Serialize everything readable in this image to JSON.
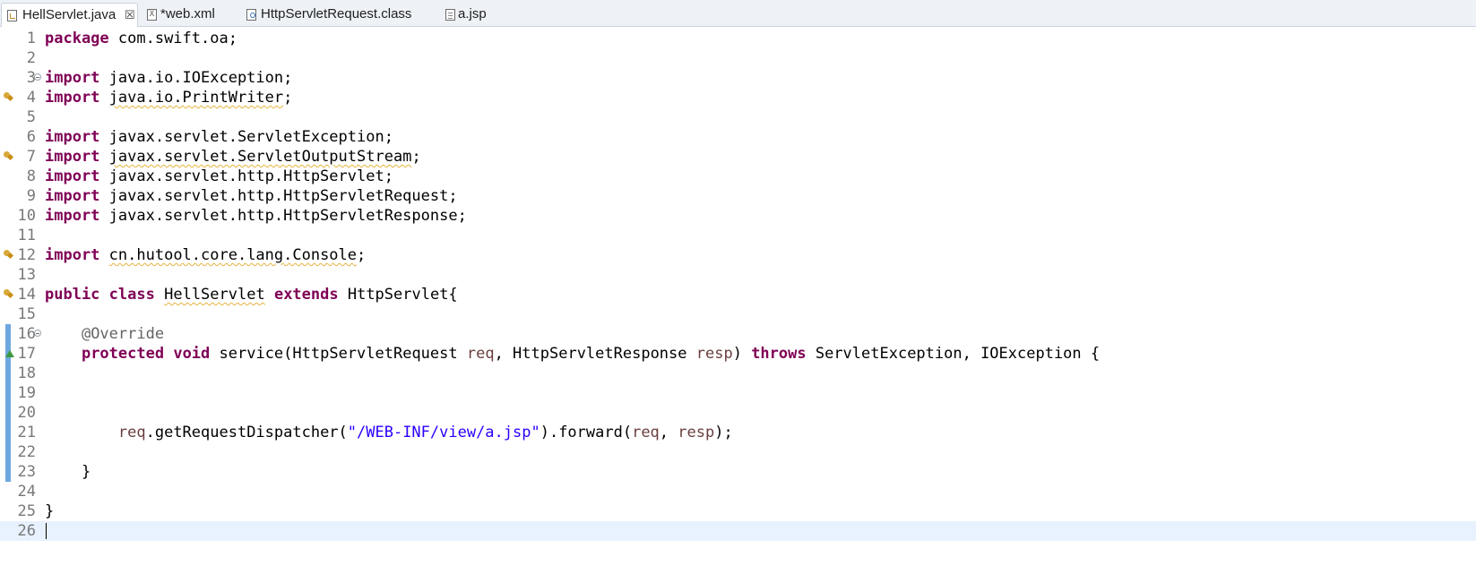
{
  "tabs": [
    {
      "label": "HellServlet.java",
      "active": true,
      "icon": "java-file-icon",
      "close": "☒"
    },
    {
      "label": "*web.xml",
      "active": false,
      "icon": "xml-file-icon",
      "icon_glyph": "X"
    },
    {
      "label": "HttpServletRequest.class",
      "active": false,
      "icon": "class-file-icon"
    },
    {
      "label": "a.jsp",
      "active": false,
      "icon": "jsp-file-icon"
    }
  ],
  "editor": {
    "line_numbers": [
      "1",
      "2",
      "3",
      "4",
      "5",
      "6",
      "7",
      "8",
      "9",
      "10",
      "11",
      "12",
      "13",
      "14",
      "15",
      "16",
      "17",
      "18",
      "19",
      "20",
      "21",
      "22",
      "23",
      "24",
      "25",
      "26"
    ],
    "current_line": "26",
    "colors": {
      "keyword": "#7f0055",
      "string": "#2a00ff",
      "annotation": "#646464",
      "parameter": "#6a3e3e",
      "current_line_bg": "#e8f2fe"
    },
    "code": {
      "l1": {
        "kw": "package",
        "rest": " com.swift.oa;"
      },
      "l3": {
        "kw": "import",
        "rest": " java.io.IOException;"
      },
      "l4": {
        "kw": "import",
        "pre": " ",
        "warn": "java.io.PrintWriter",
        "post": ";"
      },
      "l6": {
        "kw": "import",
        "rest": " javax.servlet.ServletException;"
      },
      "l7": {
        "kw": "import",
        "pre": " ",
        "warn": "javax.servlet.ServletOutputStream",
        "post": ";"
      },
      "l8": {
        "kw": "import",
        "rest": " javax.servlet.http.HttpServlet;"
      },
      "l9": {
        "kw": "import",
        "rest": " javax.servlet.http.HttpServletRequest;"
      },
      "l10": {
        "kw": "import",
        "rest": " javax.servlet.http.HttpServletResponse;"
      },
      "l12": {
        "kw": "import",
        "pre": " ",
        "warn": "cn.hutool.core.lang.Console",
        "post": ";"
      },
      "l14": {
        "kw1": "public",
        "kw2": "class",
        "name": "HellServlet",
        "kw3": "extends",
        "rest": " HttpServlet{"
      },
      "l16": {
        "annotation": "@Override"
      },
      "l17": {
        "kw1": "protected",
        "kw2": "void",
        "t1": " service(HttpServletRequest ",
        "p1": "req",
        "t2": ", HttpServletResponse ",
        "p2": "resp",
        "t3": ") ",
        "kw3": "throws",
        "t4": " ServletException, IOException {"
      },
      "l21": {
        "p1": "req",
        "t1": ".getRequestDispatcher(",
        "str": "\"/WEB-INF/view/a.jsp\"",
        "t2": ").forward(",
        "p2": "req",
        "t3": ", ",
        "p3": "resp",
        "t4": ");"
      },
      "l23": {
        "text": "}"
      },
      "l25": {
        "text": "}"
      }
    }
  }
}
